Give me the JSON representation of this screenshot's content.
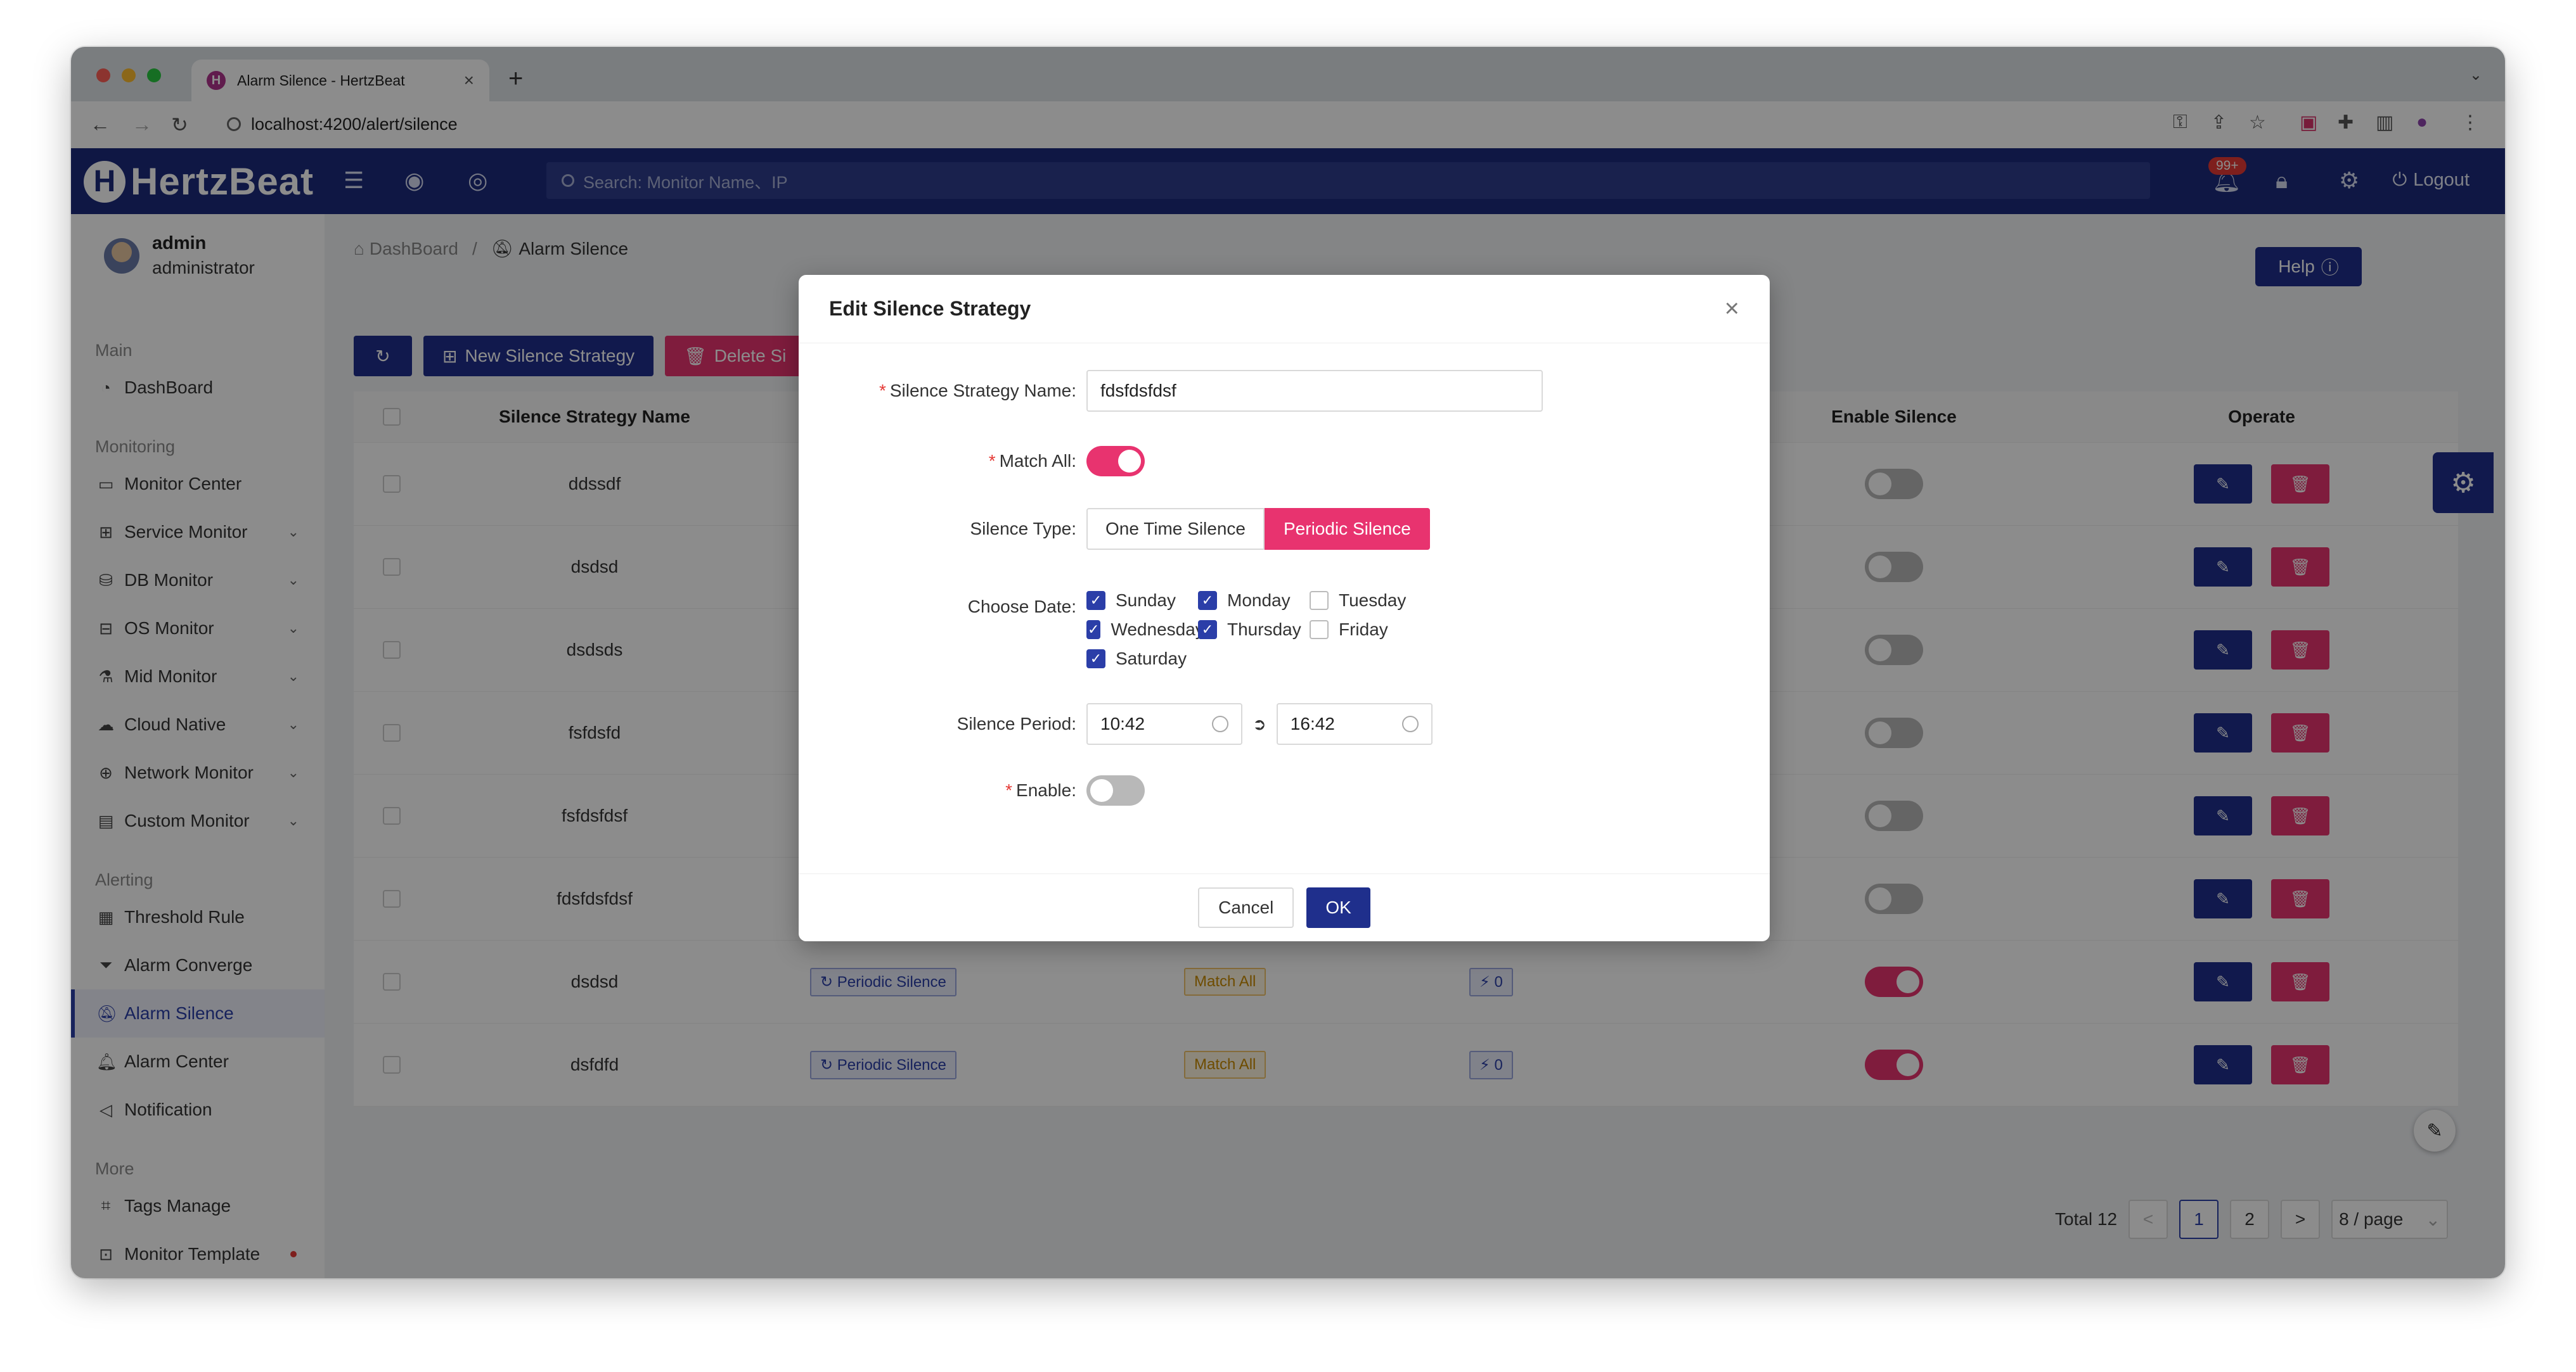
{
  "browser": {
    "tab_title": "Alarm Silence - HertzBeat",
    "url": "localhost:4200/alert/silence"
  },
  "header": {
    "brand": "HertzBeat",
    "search_placeholder": "Search: Monitor Name、IP",
    "notify_badge": "99+",
    "logout": "Logout"
  },
  "sidebar": {
    "user_name": "admin",
    "user_role": "administrator",
    "groups": {
      "main": "Main",
      "monitoring": "Monitoring",
      "alerting": "Alerting",
      "more": "More"
    },
    "items": [
      {
        "label": "DashBoard",
        "icon": "dashboard-icon"
      },
      {
        "label": "Monitor Center",
        "icon": "monitor-icon"
      },
      {
        "label": "Service Monitor",
        "icon": "grid-icon"
      },
      {
        "label": "DB Monitor",
        "icon": "database-icon"
      },
      {
        "label": "OS Monitor",
        "icon": "os-icon"
      },
      {
        "label": "Mid Monitor",
        "icon": "middleware-icon"
      },
      {
        "label": "Cloud Native",
        "icon": "cloud-icon"
      },
      {
        "label": "Network Monitor",
        "icon": "globe-icon"
      },
      {
        "label": "Custom Monitor",
        "icon": "custom-icon"
      },
      {
        "label": "Threshold Rule",
        "icon": "rule-icon"
      },
      {
        "label": "Alarm Converge",
        "icon": "filter-icon"
      },
      {
        "label": "Alarm Silence",
        "icon": "mute-icon"
      },
      {
        "label": "Alarm Center",
        "icon": "bell-icon"
      },
      {
        "label": "Notification",
        "icon": "notification-icon"
      },
      {
        "label": "Tags Manage",
        "icon": "tag-icon"
      },
      {
        "label": "Monitor Template",
        "icon": "template-icon"
      }
    ]
  },
  "breadcrumb": {
    "home": "DashBoard",
    "sep": "/",
    "current": "Alarm Silence"
  },
  "help_button": "Help",
  "toolbar": {
    "new_label": "New Silence Strategy",
    "delete_label": "Delete Si"
  },
  "table": {
    "headers": {
      "name": "Silence Strategy Name",
      "enable": "Enable Silence",
      "operate": "Operate"
    },
    "rows": [
      {
        "name": "ddssdf",
        "type": "",
        "match": "",
        "tags": "",
        "enabled": false
      },
      {
        "name": "dsdsd",
        "type": "",
        "match": "",
        "tags": "",
        "enabled": false
      },
      {
        "name": "dsdsds",
        "type": "",
        "match": "",
        "tags": "",
        "enabled": false
      },
      {
        "name": "fsfdsfd",
        "type": "",
        "match": "",
        "tags": "",
        "enabled": false
      },
      {
        "name": "fsfdsfdsf",
        "type": "",
        "match": "",
        "tags": "",
        "enabled": false
      },
      {
        "name": "fdsfdsfdsf",
        "type": "",
        "match": "",
        "tags": "",
        "enabled": false
      },
      {
        "name": "dsdsd",
        "type": "Periodic Silence",
        "match": "Match All",
        "tags": "0",
        "enabled": true
      },
      {
        "name": "dsfdfd",
        "type": "Periodic Silence",
        "match": "Match All",
        "tags": "0",
        "enabled": true
      }
    ]
  },
  "pagination": {
    "total": "Total 12",
    "prev": "<",
    "pages": [
      "1",
      "2"
    ],
    "current": "1",
    "next": ">",
    "page_size": "8 / page"
  },
  "modal": {
    "title": "Edit Silence Strategy",
    "name_label": "Silence Strategy Name",
    "name_value": "fdsfdsfdsf",
    "match_all_label": "Match All",
    "match_all": true,
    "type_label": "Silence Type",
    "type_options": [
      "One Time Silence",
      "Periodic Silence"
    ],
    "type_selected": "Periodic Silence",
    "date_label": "Choose Date",
    "days": [
      {
        "label": "Sunday",
        "checked": true
      },
      {
        "label": "Monday",
        "checked": true
      },
      {
        "label": "Tuesday",
        "checked": false
      },
      {
        "label": "Wednesday",
        "checked": true
      },
      {
        "label": "Thursday",
        "checked": true
      },
      {
        "label": "Friday",
        "checked": false
      },
      {
        "label": "Saturday",
        "checked": true
      }
    ],
    "period_label": "Silence Period",
    "period_start": "10:42",
    "period_end": "16:42",
    "enable_label": "Enable",
    "enable": false,
    "cancel": "Cancel",
    "ok": "OK"
  },
  "colors": {
    "primary": "#1f2f8c",
    "accent": "#e8336f",
    "header_bg": "#1c2a7c"
  }
}
